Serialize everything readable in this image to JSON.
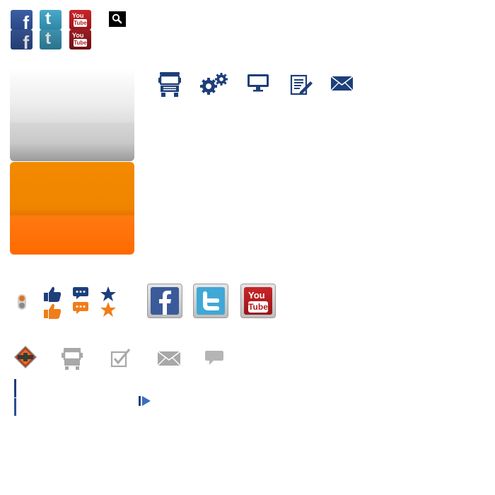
{
  "social_small": {
    "facebook": "f",
    "twitter": "t",
    "youtube_you": "You",
    "youtube_tube": "Tube"
  },
  "social_large": {
    "youtube_you": "You",
    "youtube_tube": "Tube"
  },
  "icons": {
    "nav": [
      "truck-icon",
      "gears-icon",
      "monitor-icon",
      "edit-document-icon",
      "mail-icon"
    ],
    "sprites": [
      "slider-dots-icon",
      "thumbs-up-icon",
      "chat-bubble-icon",
      "star-icon"
    ],
    "gray_row": [
      "international-logo-icon",
      "truck-icon",
      "checkbox-icon",
      "mail-icon",
      "speech-bubble-icon"
    ]
  },
  "colors": {
    "navy": "#1d3f7a",
    "orange": "#f07d1a",
    "gray_icon": "#a8a8a8"
  }
}
